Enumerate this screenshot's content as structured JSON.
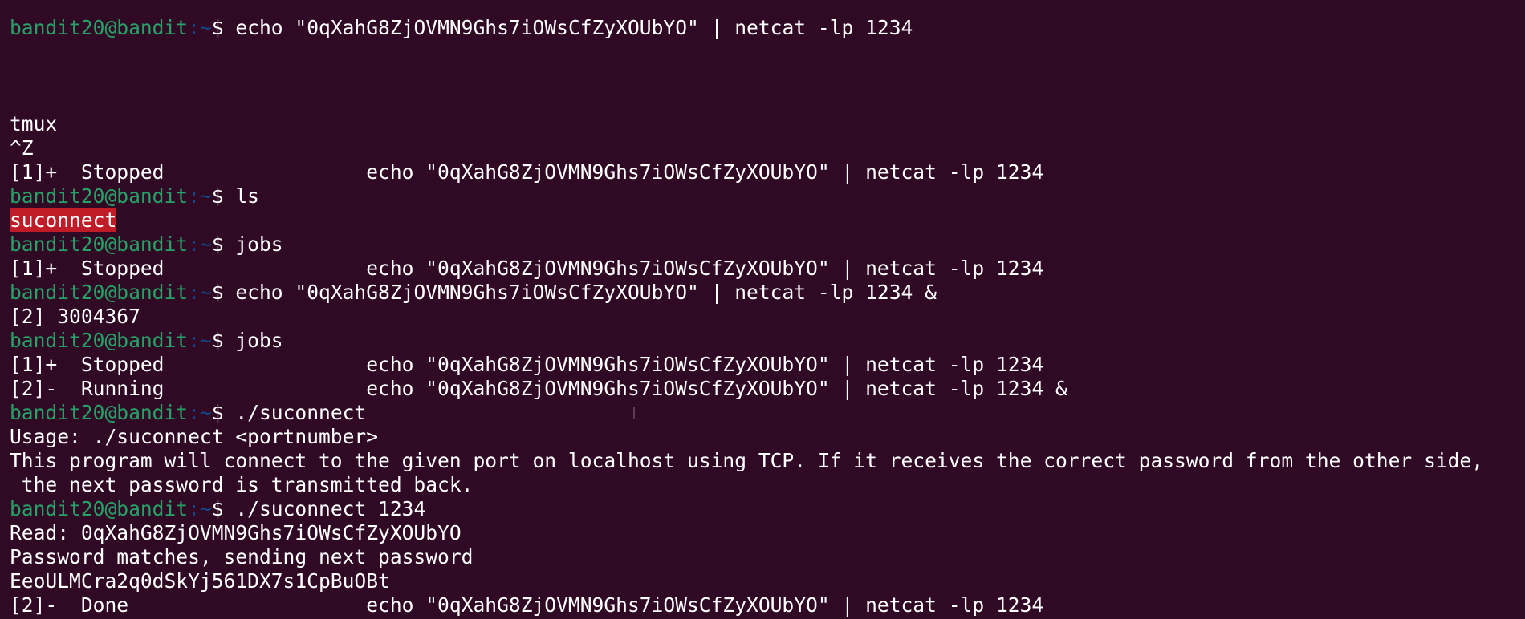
{
  "prompt": {
    "user_host": "bandit20@bandit",
    "path": "~",
    "symbol": "$ "
  },
  "lines": [
    {
      "type": "prompt",
      "cmd": "echo \"0qXahG8ZjOVMN9Ghs7iOWsCfZyXOUbYO\" | netcat -lp 1234"
    },
    {
      "type": "blank"
    },
    {
      "type": "blank"
    },
    {
      "type": "blank"
    },
    {
      "type": "out",
      "text": "tmux"
    },
    {
      "type": "out",
      "text": "^Z"
    },
    {
      "type": "out",
      "text": "[1]+  Stopped                 echo \"0qXahG8ZjOVMN9Ghs7iOWsCfZyXOUbYO\" | netcat -lp 1234"
    },
    {
      "type": "prompt",
      "cmd": "ls"
    },
    {
      "type": "hl",
      "text": "suconnect"
    },
    {
      "type": "prompt",
      "cmd": "jobs"
    },
    {
      "type": "out",
      "text": "[1]+  Stopped                 echo \"0qXahG8ZjOVMN9Ghs7iOWsCfZyXOUbYO\" | netcat -lp 1234"
    },
    {
      "type": "prompt",
      "cmd": "echo \"0qXahG8ZjOVMN9Ghs7iOWsCfZyXOUbYO\" | netcat -lp 1234 &"
    },
    {
      "type": "out",
      "text": "[2] 3004367"
    },
    {
      "type": "prompt",
      "cmd": "jobs"
    },
    {
      "type": "out",
      "text": "[1]+  Stopped                 echo \"0qXahG8ZjOVMN9Ghs7iOWsCfZyXOUbYO\" | netcat -lp 1234"
    },
    {
      "type": "out",
      "text": "[2]-  Running                 echo \"0qXahG8ZjOVMN9Ghs7iOWsCfZyXOUbYO\" | netcat -lp 1234 &"
    },
    {
      "type": "prompt",
      "cmd": "./suconnect"
    },
    {
      "type": "out",
      "text": "Usage: ./suconnect <portnumber>"
    },
    {
      "type": "out",
      "text": "This program will connect to the given port on localhost using TCP. If it receives the correct password from the other side,"
    },
    {
      "type": "out",
      "text": " the next password is transmitted back."
    },
    {
      "type": "prompt",
      "cmd": "./suconnect 1234"
    },
    {
      "type": "out",
      "text": "Read: 0qXahG8ZjOVMN9Ghs7iOWsCfZyXOUbYO"
    },
    {
      "type": "out",
      "text": "Password matches, sending next password"
    },
    {
      "type": "out",
      "text": "EeoULMCra2q0dSkYj561DX7s1CpBuOBt"
    },
    {
      "type": "out",
      "text": "[2]-  Done                    echo \"0qXahG8ZjOVMN9Ghs7iOWsCfZyXOUbYO\" | netcat -lp 1234"
    }
  ],
  "colors": {
    "background": "#300a24",
    "user_host": "#26a269",
    "path": "#12488b",
    "text": "#ffffff",
    "highlight_bg": "#c01c28"
  }
}
